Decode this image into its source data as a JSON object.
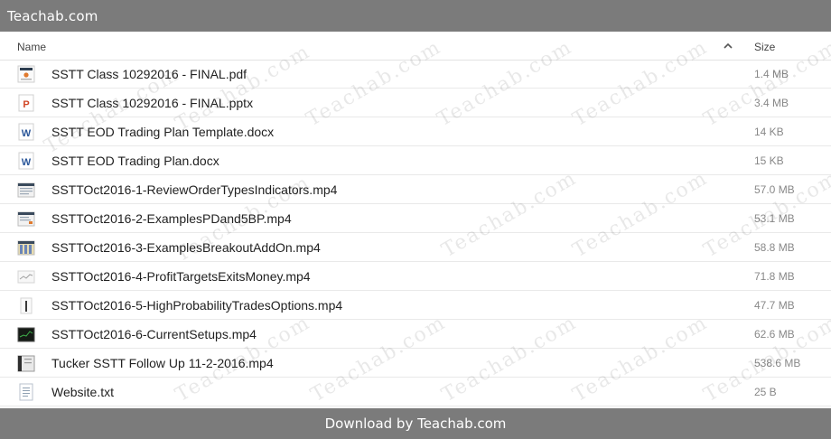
{
  "topbar": {
    "title": "Teachab.com"
  },
  "header": {
    "name_label": "Name",
    "size_label": "Size",
    "sort_icon": "chevron-up-icon"
  },
  "files": [
    {
      "name": "SSTT Class 10292016 - FINAL.pdf",
      "size": "1.4 MB",
      "icon": "pdf-thumbnail-icon"
    },
    {
      "name": "SSTT Class 10292016 - FINAL.pptx",
      "size": "3.4 MB",
      "icon": "powerpoint-icon"
    },
    {
      "name": "SSTT EOD Trading Plan Template.docx",
      "size": "14 KB",
      "icon": "word-icon"
    },
    {
      "name": "SSTT EOD Trading Plan.docx",
      "size": "15 KB",
      "icon": "word-icon"
    },
    {
      "name": "SSTTOct2016-1-ReviewOrderTypesIndicators.mp4",
      "size": "57.0 MB",
      "icon": "video-thumbnail-icon"
    },
    {
      "name": "SSTTOct2016-2-ExamplesPDand5BP.mp4",
      "size": "53.1 MB",
      "icon": "video-thumbnail-icon"
    },
    {
      "name": "SSTTOct2016-3-ExamplesBreakoutAddOn.mp4",
      "size": "58.8 MB",
      "icon": "video-thumbnail-icon"
    },
    {
      "name": "SSTTOct2016-4-ProfitTargetsExitsMoney.mp4",
      "size": "71.8 MB",
      "icon": "video-thumbnail-icon"
    },
    {
      "name": "SSTTOct2016-5-HighProbabilityTradesOptions.mp4",
      "size": "47.7 MB",
      "icon": "video-thumbnail-icon"
    },
    {
      "name": "SSTTOct2016-6-CurrentSetups.mp4",
      "size": "62.6 MB",
      "icon": "video-thumbnail-icon"
    },
    {
      "name": "Tucker SSTT Follow Up 11-2-2016.mp4",
      "size": "538.6 MB",
      "icon": "video-thumbnail-icon"
    },
    {
      "name": "Website.txt",
      "size": "25 B",
      "icon": "text-file-icon"
    }
  ],
  "footer": {
    "download_label": "Download by Teachab.com"
  },
  "watermark": {
    "text": "Teachab.com"
  },
  "colors": {
    "bar": "#7b7b7b",
    "word_blue": "#2b579a",
    "ppt_red": "#d24726"
  }
}
